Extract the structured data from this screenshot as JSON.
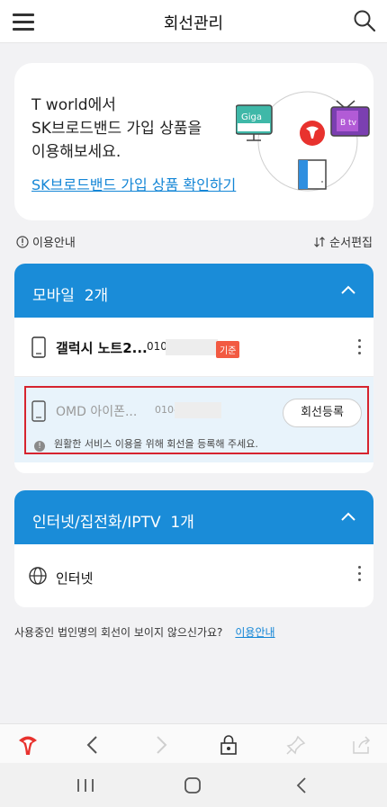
{
  "header": {
    "title": "회선관리",
    "menu_icon": "hamburger-menu-icon",
    "search_icon": "search-icon"
  },
  "promo": {
    "line1": "T world에서",
    "line2": "SK브로드밴드 가입 상품을",
    "line3": "이용해보세요.",
    "link": "SK브로드밴드 가입 상품 확인하기",
    "art_labels": {
      "giga": "Giga",
      "btv": "B tv"
    }
  },
  "info_bar": {
    "guide": "이용안내",
    "reorder": "순서편집"
  },
  "mobile_section": {
    "title": "모바일",
    "count": "2개",
    "lines": [
      {
        "name": "갤럭시 노트2...",
        "number_prefix": "010",
        "badge": "기준"
      }
    ],
    "pending": {
      "name": "OMD 아이폰...",
      "number_prefix": "010-",
      "register_label": "회선등록",
      "notice": "원활한 서비스 이용을 위해 회선을 등록해 주세요."
    }
  },
  "internet_section": {
    "title": "인터넷/집전화/IPTV",
    "count": "1개",
    "lines": [
      {
        "label": "인터넷"
      }
    ]
  },
  "footer_note": {
    "text": "사용중인 법인명의 회선이 보이지 않으신가요?",
    "link": "이용안내"
  },
  "colors": {
    "accent": "#1a8cd8",
    "badge": "#f25a42",
    "highlight_border": "#d6242f",
    "brand_red": "#e8322e"
  }
}
